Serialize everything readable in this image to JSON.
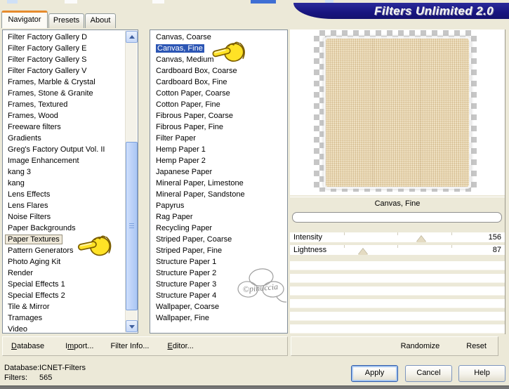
{
  "window": {
    "title": "Filters Unlimited 2.0"
  },
  "tabs": [
    {
      "label": "Navigator",
      "active": true
    },
    {
      "label": "Presets",
      "active": false
    },
    {
      "label": "About",
      "active": false
    }
  ],
  "category_list": {
    "items": [
      "Filter Factory Gallery D",
      "Filter Factory Gallery E",
      "Filter Factory Gallery S",
      "Filter Factory Gallery V",
      "Frames, Marble & Crystal",
      "Frames, Stone & Granite",
      "Frames, Textured",
      "Frames, Wood",
      "Freeware filters",
      "Gradients",
      "Greg's Factory Output Vol. II",
      "Image Enhancement",
      "kang 3",
      "kang",
      "Lens Effects",
      "Lens Flares",
      "Noise Filters",
      "Paper Backgrounds",
      "Paper Textures",
      "Pattern Generators",
      "Photo Aging Kit",
      "Render",
      "Special Effects 1",
      "Special Effects 2",
      "Tile & Mirror",
      "Tramages",
      "Video"
    ],
    "selected": "Paper Textures"
  },
  "filter_list": {
    "items": [
      "Canvas, Coarse",
      "Canvas, Fine",
      "Canvas, Medium",
      "Cardboard Box, Coarse",
      "Cardboard Box, Fine",
      "Cotton Paper, Coarse",
      "Cotton Paper, Fine",
      "Fibrous Paper, Coarse",
      "Fibrous Paper, Fine",
      "Filter Paper",
      "Hemp Paper 1",
      "Hemp Paper 2",
      "Japanese Paper",
      "Mineral Paper, Limestone",
      "Mineral Paper, Sandstone",
      "Papyrus",
      "Rag Paper",
      "Recycling Paper",
      "Striped Paper, Coarse",
      "Striped Paper, Fine",
      "Structure Paper 1",
      "Structure Paper 2",
      "Structure Paper 3",
      "Structure Paper 4",
      "Wallpaper, Coarse",
      "Wallpaper, Fine"
    ],
    "selected": "Canvas, Fine"
  },
  "preview": {
    "caption": "Canvas, Fine",
    "progress_percent": 0
  },
  "sliders": [
    {
      "label": "Intensity",
      "value": "156",
      "percent": 61
    },
    {
      "label": "Lightness",
      "value": "87",
      "percent": 34
    }
  ],
  "empty_slider_rows": 6,
  "toolbar": {
    "items": [
      {
        "pre": "",
        "u": "D",
        "post": "atabase"
      },
      {
        "pre": "I",
        "u": "m",
        "post": "port..."
      },
      {
        "pre": "",
        "u": "",
        "post": "Filter Info..."
      },
      {
        "pre": "",
        "u": "E",
        "post": "ditor..."
      }
    ],
    "randomize": "Randomize",
    "reset": "Reset"
  },
  "status": {
    "database_label": "Database:",
    "database_value": "ICNET-Filters",
    "filters_label": "Filters:",
    "filters_value": "565"
  },
  "buttons": {
    "apply": "Apply",
    "cancel": "Cancel",
    "help": "Help"
  },
  "watermark_text": "©pinuccia",
  "colors": {
    "dialog_bg": "#ece9d8",
    "title_navy": "#181580",
    "selection_blue": "#2b55b4",
    "canvas_beige": "#ead7b0",
    "checker_gray": "#c6c6c6",
    "hand_yellow": "#ffe226",
    "tab_accent_orange": "#e68b2c"
  }
}
